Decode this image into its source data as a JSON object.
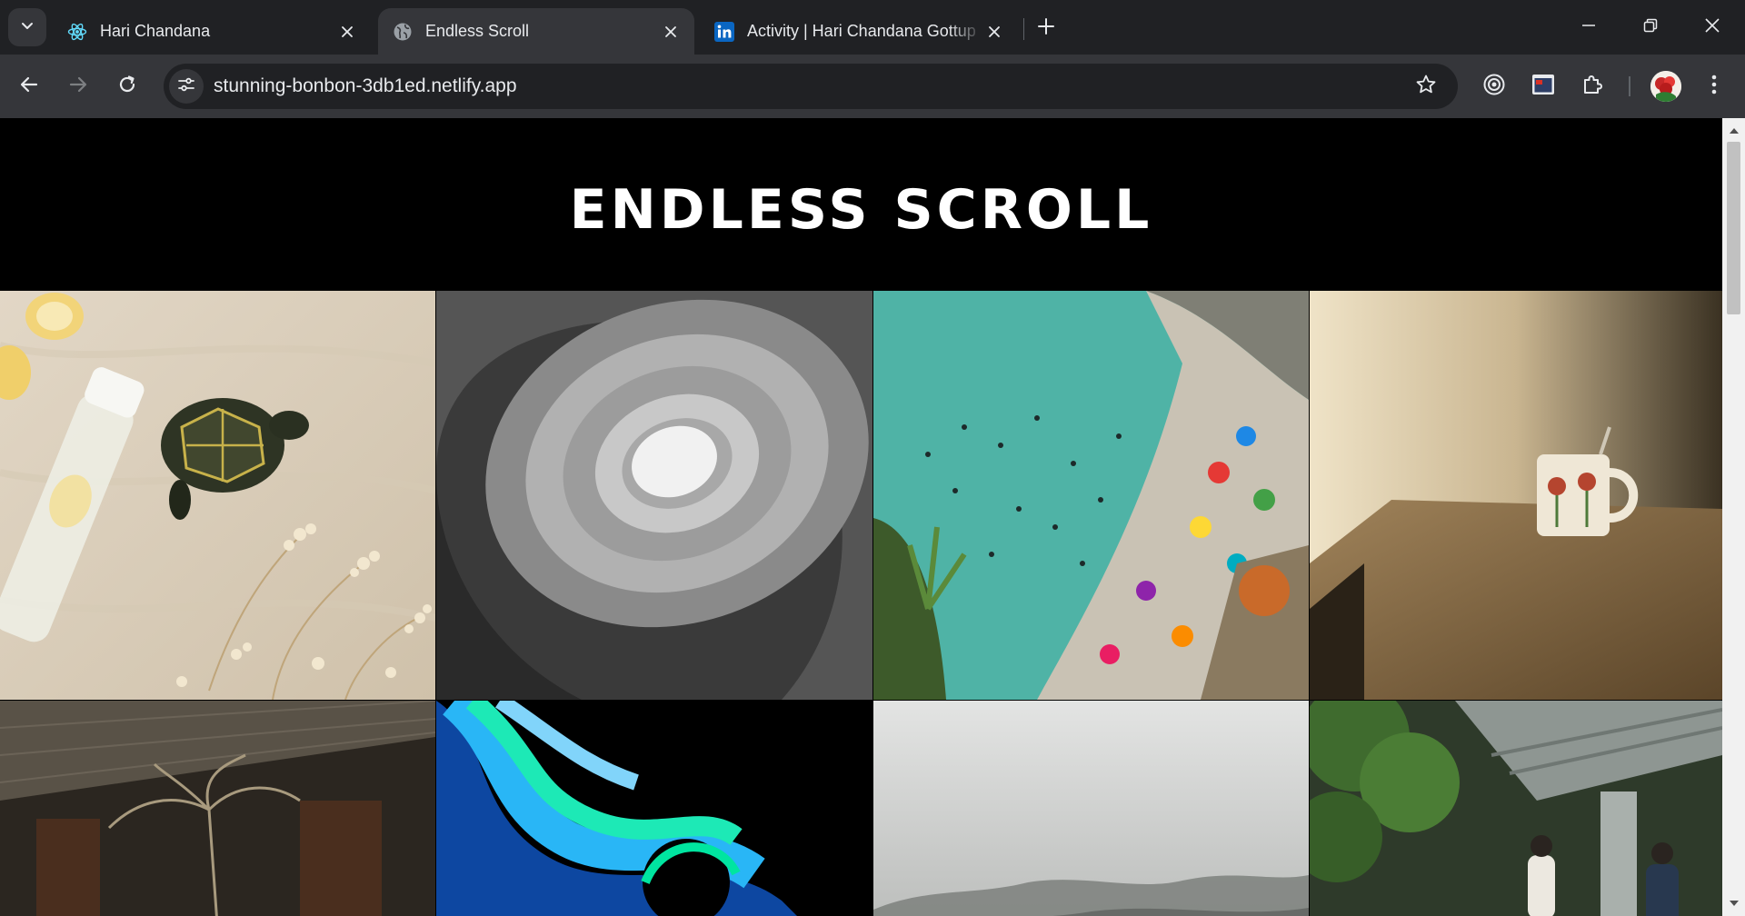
{
  "tabs": [
    {
      "label": "Hari Chandana",
      "favicon": "react-atom-icon",
      "active": false
    },
    {
      "label": "Endless Scroll",
      "favicon": "globe-icon",
      "active": true
    },
    {
      "label": "Activity | Hari Chandana Gottup",
      "favicon": "linkedin-icon",
      "active": false
    }
  ],
  "address_bar": {
    "url": "stunning-bonbon-3db1ed.netlify.app"
  },
  "page": {
    "title": "ENDLESS SCROLL",
    "photos": [
      {
        "subject": "turtle with water bottle and dried flowers on linen"
      },
      {
        "subject": "spiral staircase viewed from below, black and white"
      },
      {
        "subject": "crowded beach with swimmers and umbrellas from above"
      },
      {
        "subject": "mug on wooden table by sunlit window"
      },
      {
        "subject": "wooden house porch with dried palm"
      },
      {
        "subject": "abstract blue and green swirl"
      },
      {
        "subject": "foggy mountains"
      },
      {
        "subject": "people under temple roof with greenery"
      }
    ]
  },
  "colors": {
    "tab_strip": "#202124",
    "toolbar": "#35363a",
    "page_background": "#000000",
    "title_text": "#ffffff"
  }
}
